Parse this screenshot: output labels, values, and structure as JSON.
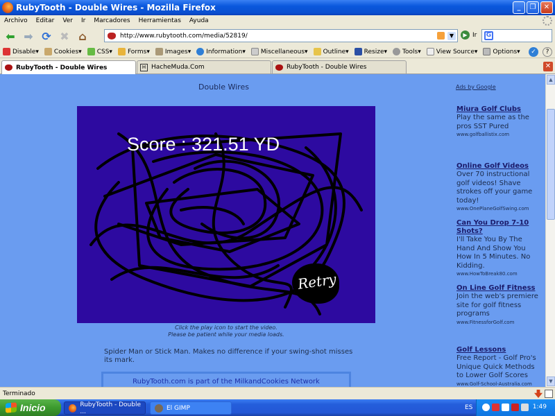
{
  "window": {
    "title": "RubyTooth - Double Wires - Mozilla Firefox"
  },
  "menu": [
    "Archivo",
    "Editar",
    "Ver",
    "Ir",
    "Marcadores",
    "Herramientas",
    "Ayuda"
  ],
  "navbar": {
    "url": "http://www.rubytooth.com/media/52819/",
    "go_label": "Ir",
    "search_value": ""
  },
  "devbar": [
    "Disable",
    "Cookies",
    "CSS",
    "Forms",
    "Images",
    "Information",
    "Miscellaneous",
    "Outline",
    "Resize",
    "Tools",
    "View Source",
    "Options"
  ],
  "tabs": [
    {
      "label": "RubyTooth - Double Wires"
    },
    {
      "label": "HacheMuda.Com"
    },
    {
      "label": "RubyTooth - Double Wires"
    }
  ],
  "page": {
    "title": "Double Wires",
    "score": "Score : 321.51 YD",
    "retry": "Retry",
    "caption1": "Click the play icon to start the video.",
    "caption2": "Please be patient while your media loads.",
    "description": "Spider Man or Stick Man. Makes no difference if your swing-shot misses its mark.",
    "network": "RubyTooth.com is part of the MilkandCookies Network"
  },
  "ads": {
    "header": "Ads by Google",
    "items": [
      {
        "title": "Miura Golf Clubs",
        "body": "Play the same as the pros SST Pured",
        "url": "www.golfballistix.com"
      },
      {
        "title": "Online Golf Videos",
        "body": "Over 70 instructional golf videos! Shave strokes off your game today!",
        "url": "www.OnePlaneGolfSwing.com"
      },
      {
        "title": "Can You Drop 7-10 Shots?",
        "body": "I'll Take You By The Hand And Show You How In 5 Minutes. No Kidding.",
        "url": "www.HowToBreak80.com"
      },
      {
        "title": "On Line Golf Fitness",
        "body": "Join the web's premiere site for golf fitness programs",
        "url": "www.FitnessforGolf.com"
      },
      {
        "title": "Golf Lessons",
        "body": "Free Report - Golf Pro's Unique Quick Methods to Lower Golf Scores",
        "url": "www.Golf-School-Australia.com"
      }
    ]
  },
  "status": "Terminado",
  "taskbar": {
    "start": "Inicio",
    "tasks": [
      "RubyTooth - Double ...",
      "El GIMP"
    ],
    "lang": "ES",
    "clock": "1:49"
  },
  "colors": {
    "page_bg": "#6a9cf0",
    "game_bg": "#2d0aa0"
  }
}
